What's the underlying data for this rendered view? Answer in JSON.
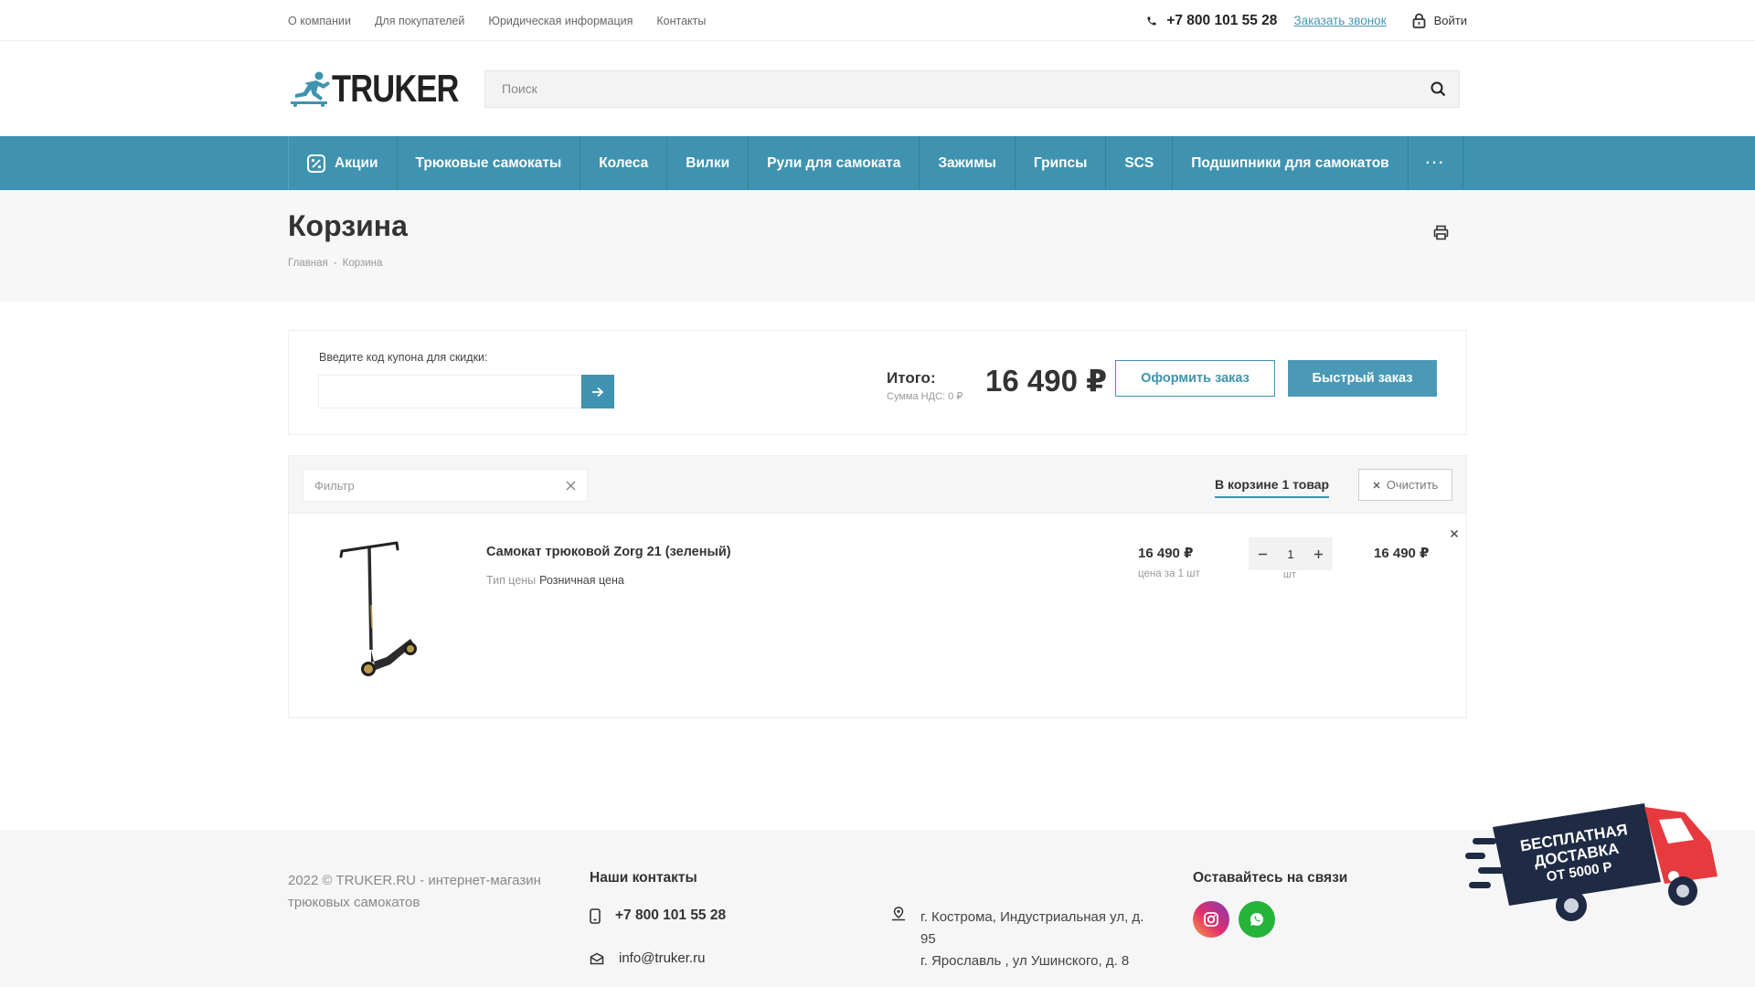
{
  "topbar": {
    "links": [
      "О компании",
      "Для покупателей",
      "Юридическая информация",
      "Контакты"
    ],
    "phone": "+7 800 101 55 28",
    "callback": "Заказать звонок",
    "login": "Войти"
  },
  "header": {
    "logo": "TRUKER",
    "search_placeholder": "Поиск"
  },
  "nav": {
    "items": [
      "Акции",
      "Трюковые самокаты",
      "Колеса",
      "Вилки",
      "Рули для самоката",
      "Зажимы",
      "Грипсы",
      "SCS",
      "Подшипники для самокатов"
    ],
    "more": "···"
  },
  "page": {
    "title": "Корзина",
    "breadcrumb": [
      "Главная",
      "-",
      "Корзина"
    ]
  },
  "summary": {
    "coupon_label": "Введите код купона для скидки:",
    "total_label": "Итого:",
    "vat": "Сумма НДС: 0 ₽",
    "total": "16 490 ₽",
    "order_button": "Оформить заказ",
    "quick_button": "Быстрый заказ"
  },
  "cart": {
    "filter_placeholder": "Фильтр",
    "count_label": "В корзине 1 товар",
    "clear_label": "Очистить",
    "items": [
      {
        "name": "Самокат трюковой Zorg 21 (зеленый)",
        "prop_label": "Тип цены",
        "prop_value": "Розничная цена",
        "price": "16 490 ₽",
        "price_note": "цена за 1 шт",
        "qty": "1",
        "qty_unit": "шт",
        "sum": "16 490 ₽"
      }
    ]
  },
  "footer": {
    "copyright": "2022 © TRUKER.RU - интернет-магазин трюковых самокатов",
    "contacts_title": "Наши контакты",
    "phone": "+7 800 101 55 28",
    "email": "info@truker.ru",
    "address_1": "г. Кострома, Индустриальная ул, д. 95",
    "address_2": "г. Ярославль , ул Ушинского, д. 8",
    "social_title": "Оставайтесь на связи"
  },
  "delivery_badge": {
    "line1": "БЕСПЛАТНАЯ",
    "line2": "ДОСТАВКА",
    "line3": "ОТ 5000 Р"
  },
  "colors": {
    "accent": "#3f93b0",
    "delivery_red": "#e63a3f",
    "delivery_dark": "#1f2a44"
  }
}
